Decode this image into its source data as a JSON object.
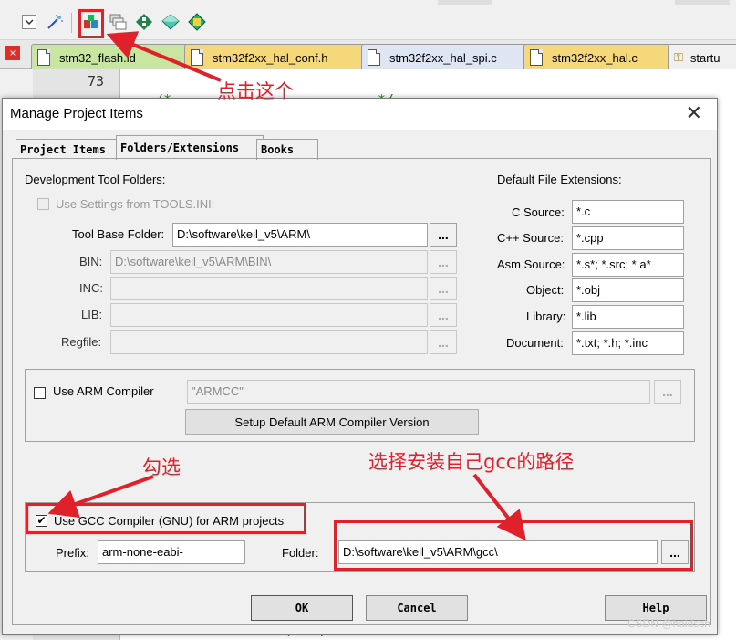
{
  "toolbar": {
    "icons": [
      "dropdown-icon",
      "magic-wand-icon",
      "manage-project-items-icon",
      "batch-build-icon",
      "manage-packs-icon",
      "select-software-packs-icon",
      "pack-installer-icon"
    ]
  },
  "file_tabs": [
    {
      "label": "stm32_flash.ld",
      "color": "#c8e6a0"
    },
    {
      "label": "stm32f2xx_hal_conf.h",
      "color": "#f5d87a"
    },
    {
      "label": "stm32f2xx_hal_spi.c",
      "color": "#dde6f2"
    },
    {
      "label": "stm32f2xx_hal.c",
      "color": "#f5d87a"
    },
    {
      "label": "startu",
      "color": "#f0f0f0"
    }
  ],
  "editor": {
    "line_number": "73",
    "line_number_bottom": "80",
    "code_top": "/* ....................... */",
    "code_bottom": "/* Reset of all peripherals, Initializes"
  },
  "dialog": {
    "title": "Manage Project Items",
    "tabs": [
      "Project Items",
      "Folders/Extensions",
      "Books"
    ],
    "active_tab": "Folders/Extensions",
    "dev_tool_folders": {
      "heading": "Development Tool Folders:",
      "use_settings_label": "Use Settings from TOOLS.INI:",
      "tool_base_label": "Tool Base Folder:",
      "tool_base_value": "D:\\software\\keil_v5\\ARM\\",
      "bin_label": "BIN:",
      "bin_value": "D:\\software\\keil_v5\\ARM\\BIN\\",
      "inc_label": "INC:",
      "lib_label": "LIB:",
      "regfile_label": "Regfile:",
      "browse": "..."
    },
    "extensions": {
      "heading": "Default File Extensions:",
      "rows": [
        {
          "label": "C Source:",
          "value": "*.c"
        },
        {
          "label": "C++ Source:",
          "value": "*.cpp"
        },
        {
          "label": "Asm Source:",
          "value": "*.s*; *.src; *.a*"
        },
        {
          "label": "Object:",
          "value": "*.obj"
        },
        {
          "label": "Library:",
          "value": "*.lib"
        },
        {
          "label": "Document:",
          "value": "*.txt; *.h; *.inc"
        }
      ]
    },
    "arm_compiler": {
      "checkbox_label": "Use ARM Compiler",
      "value": "\"ARMCC\"",
      "setup_button": "Setup Default ARM Compiler Version",
      "browse": "..."
    },
    "gcc": {
      "checkbox_label": "Use GCC Compiler (GNU) for ARM projects",
      "checkmark": "✔",
      "prefix_label": "Prefix:",
      "prefix_value": "arm-none-eabi-",
      "folder_label": "Folder:",
      "folder_value": "D:\\software\\keil_v5\\ARM\\gcc\\",
      "browse": "..."
    },
    "buttons": {
      "ok": "OK",
      "cancel": "Cancel",
      "help": "Help"
    },
    "close": "✕"
  },
  "annotations": {
    "click_this": "点击这个",
    "tick": "勾选",
    "choose_path": "选择安装自己gcc的路径"
  },
  "watermark": "CSDN @haldsch",
  "colors": {
    "annotation_red": "#e0202a"
  }
}
